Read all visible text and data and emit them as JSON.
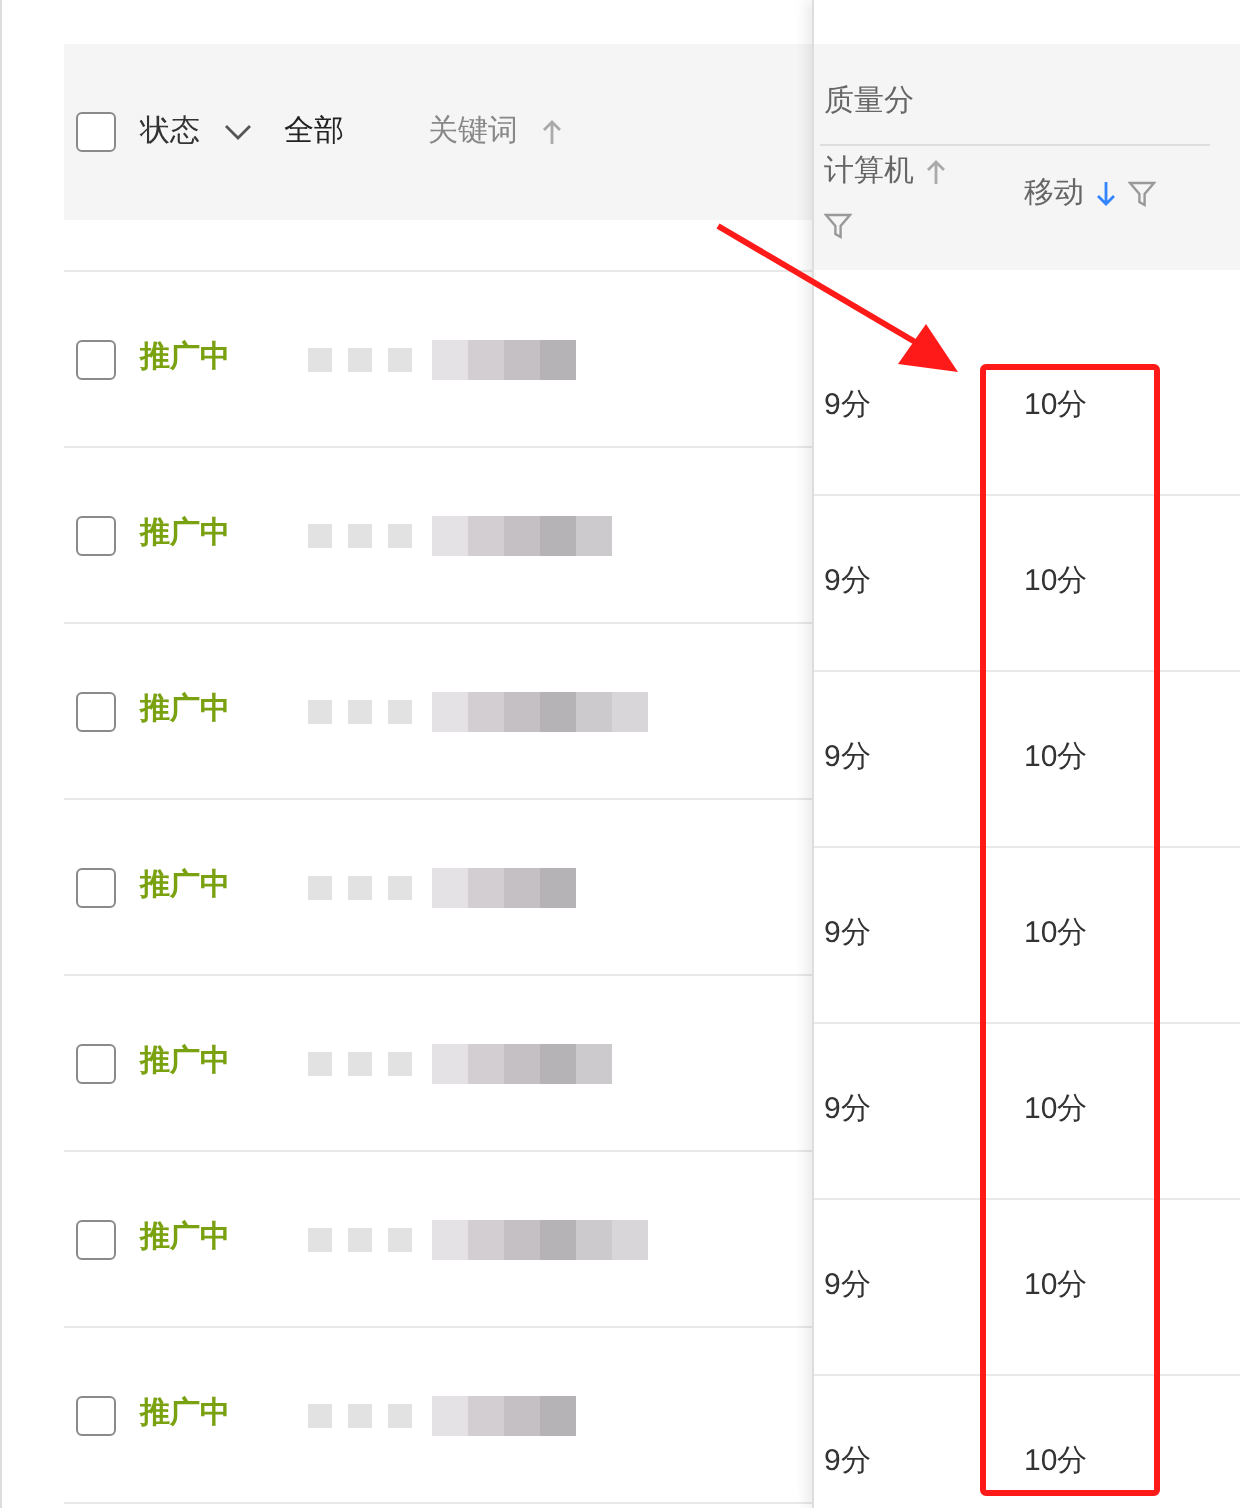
{
  "header": {
    "select_all": {
      "checked": false
    },
    "status_label": "状态",
    "status_filter": "全部",
    "keyword_label": "关键词",
    "quality_group": "质量分",
    "computer_label": "计算机",
    "mobile_label": "移动"
  },
  "rows": [
    {
      "checked": false,
      "status": "推广中",
      "computer": "9分",
      "mobile": "10分"
    },
    {
      "checked": false,
      "status": "推广中",
      "computer": "9分",
      "mobile": "10分"
    },
    {
      "checked": false,
      "status": "推广中",
      "computer": "9分",
      "mobile": "10分"
    },
    {
      "checked": false,
      "status": "推广中",
      "computer": "9分",
      "mobile": "10分"
    },
    {
      "checked": false,
      "status": "推广中",
      "computer": "9分",
      "mobile": "10分"
    },
    {
      "checked": false,
      "status": "推广中",
      "computer": "9分",
      "mobile": "10分"
    },
    {
      "checked": false,
      "status": "推广中",
      "computer": "9分",
      "mobile": "10分"
    }
  ]
}
